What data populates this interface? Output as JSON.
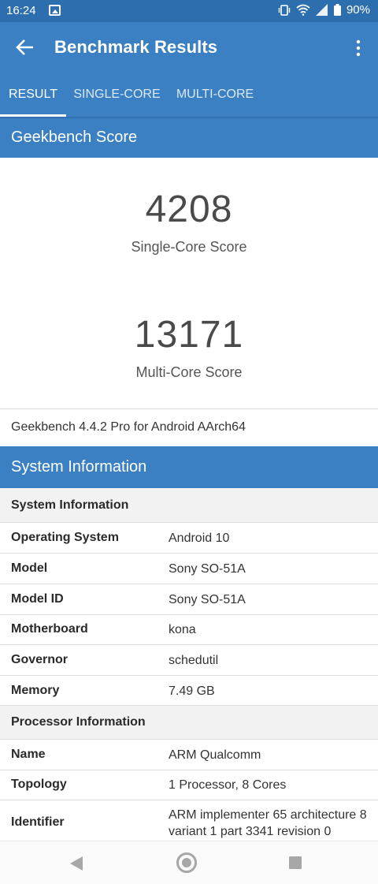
{
  "status": {
    "time": "16:24",
    "battery": "90%"
  },
  "app_bar": {
    "title": "Benchmark Results"
  },
  "tabs": [
    {
      "label": "RESULT",
      "active": true
    },
    {
      "label": "SINGLE-CORE",
      "active": false
    },
    {
      "label": "MULTI-CORE",
      "active": false
    }
  ],
  "score": {
    "header": "Geekbench Score",
    "single_value": "4208",
    "single_label": "Single-Core Score",
    "multi_value": "13171",
    "multi_label": "Multi-Core Score",
    "version": "Geekbench 4.4.2 Pro for Android AArch64"
  },
  "system": {
    "header": "System Information",
    "group1": "System Information",
    "rows1": [
      {
        "key": "Operating System",
        "value": "Android 10"
      },
      {
        "key": "Model",
        "value": "Sony SO-51A"
      },
      {
        "key": "Model ID",
        "value": "Sony SO-51A"
      },
      {
        "key": "Motherboard",
        "value": "kona"
      },
      {
        "key": "Governor",
        "value": "schedutil"
      },
      {
        "key": "Memory",
        "value": "7.49 GB"
      }
    ],
    "group2": "Processor Information",
    "rows2": [
      {
        "key": "Name",
        "value": "ARM Qualcomm"
      },
      {
        "key": "Topology",
        "value": "1 Processor, 8 Cores"
      },
      {
        "key": "Identifier",
        "value_line1": "ARM implementer 65 architecture 8",
        "value_line2": "variant 1 part 3341 revision 0"
      }
    ]
  },
  "colors": {
    "primary": "#3a80c3",
    "status_bar": "#2d6fae"
  }
}
